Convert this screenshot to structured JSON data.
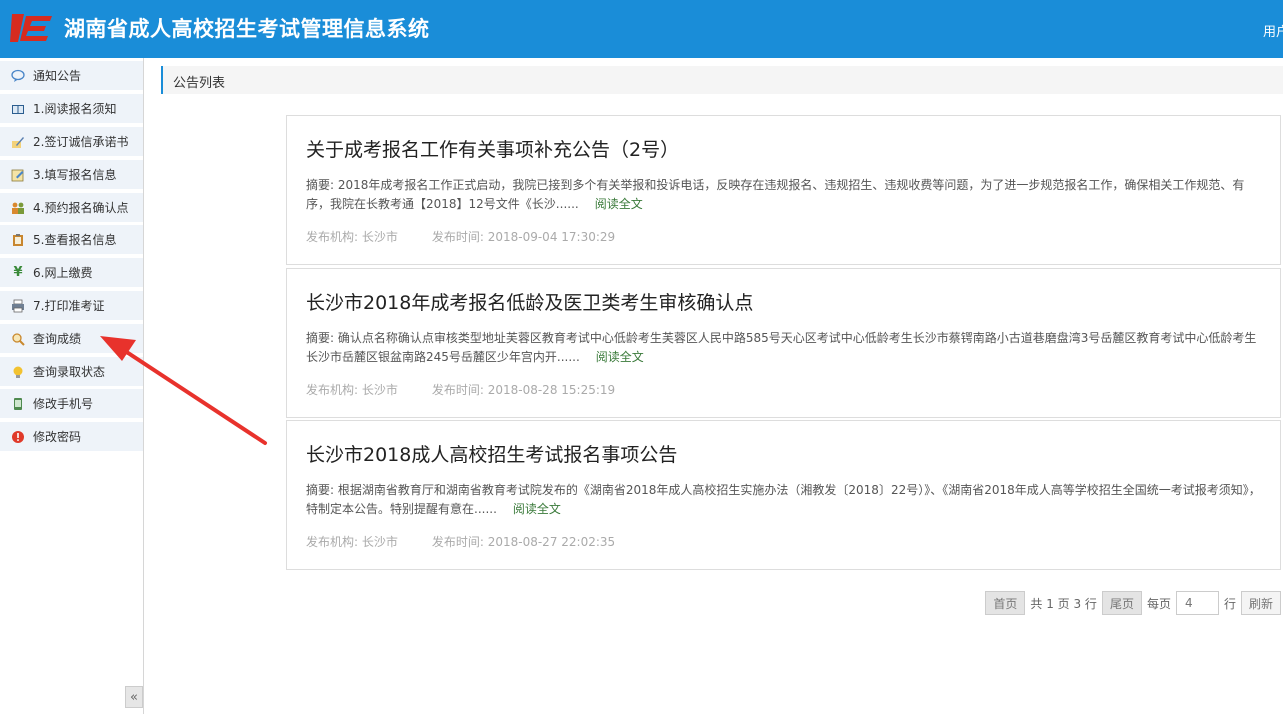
{
  "header": {
    "title": "湖南省成人高校招生考试管理信息系统",
    "user_label": "用户"
  },
  "sidebar": {
    "items": [
      {
        "label": "通知公告",
        "icon": "chat-bubble-icon"
      },
      {
        "label": "1.阅读报名须知",
        "icon": "book-icon"
      },
      {
        "label": "2.签订诚信承诺书",
        "icon": "pen-sign-icon"
      },
      {
        "label": "3.填写报名信息",
        "icon": "edit-form-icon"
      },
      {
        "label": "4.预约报名确认点",
        "icon": "people-icon"
      },
      {
        "label": "5.查看报名信息",
        "icon": "clipboard-icon"
      },
      {
        "label": "6.网上缴费",
        "icon": "yen-icon"
      },
      {
        "label": "7.打印准考证",
        "icon": "printer-icon"
      },
      {
        "label": "查询成绩",
        "icon": "magnifier-icon"
      },
      {
        "label": "查询录取状态",
        "icon": "lightbulb-icon"
      },
      {
        "label": "修改手机号",
        "icon": "phone-icon"
      },
      {
        "label": "修改密码",
        "icon": "alert-icon"
      }
    ],
    "collapse": "«"
  },
  "breadcrumb": "公告列表",
  "announcements": [
    {
      "title": "关于成考报名工作有关事项补充公告（2号）",
      "summary": "摘要: 2018年成考报名工作正式启动，我院已接到多个有关举报和投诉电话，反映存在违规报名、违规招生、违规收费等问题，为了进一步规范报名工作，确保相关工作规范、有序，我院在长教考通【2018】12号文件《长沙......",
      "read_more": "阅读全文",
      "org": "发布机构: 长沙市",
      "time": "发布时间: 2018-09-04 17:30:29"
    },
    {
      "title": "长沙市2018年成考报名低龄及医卫类考生审核确认点",
      "summary": "摘要: 确认点名称确认点审核类型地址芙蓉区教育考试中心低龄考生芙蓉区人民中路585号天心区考试中心低龄考生长沙市蔡锷南路小古道巷磨盘湾3号岳麓区教育考试中心低龄考生长沙市岳麓区银盆南路245号岳麓区少年宫内开......",
      "read_more": "阅读全文",
      "org": "发布机构: 长沙市",
      "time": "发布时间: 2018-08-28 15:25:19"
    },
    {
      "title": "长沙市2018成人高校招生考试报名事项公告",
      "summary": "摘要: 根据湖南省教育厅和湖南省教育考试院发布的《湖南省2018年成人高校招生实施办法（湘教发〔2018〕22号）》、《湖南省2018年成人高等学校招生全国统一考试报考须知》，特制定本公告。特别提醒有意在......",
      "read_more": "阅读全文",
      "org": "发布机构: 长沙市",
      "time": "发布时间: 2018-08-27 22:02:35"
    }
  ],
  "pager": {
    "first": "首页",
    "info": "共 1 页 3 行",
    "last": "尾页",
    "per_page": "每页",
    "per_page_value": "4",
    "rows_unit": "行",
    "refresh": "刷新"
  },
  "colors": {
    "header_bg": "#1a8dd8",
    "arrow": "#e8322c",
    "menu_bg": "#eef3f9"
  }
}
